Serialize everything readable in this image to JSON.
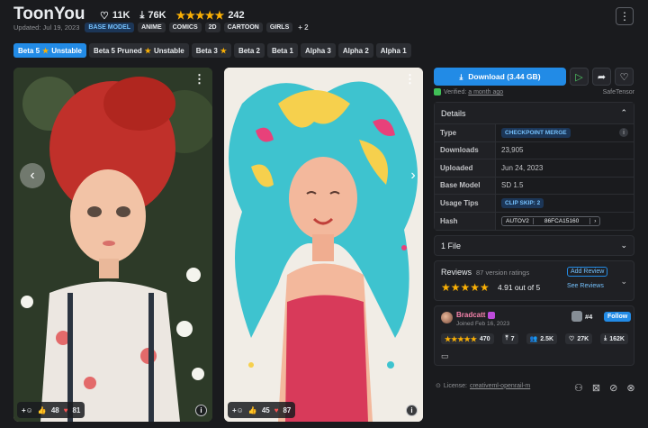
{
  "header": {
    "title": "ToonYou",
    "likes": "11K",
    "downloads": "76K",
    "rating_count": "242",
    "more_icon": "⋮"
  },
  "meta": {
    "updated": "Updated: Jul 19, 2023",
    "base_badge": "BASE MODEL",
    "tags": [
      "ANIME",
      "COMICS",
      "2D",
      "CARTOON",
      "GIRLS"
    ],
    "more_tags": "+ 2"
  },
  "versions": [
    {
      "label": "Beta 5",
      "star": true,
      "suffix": "Unstable",
      "active": true
    },
    {
      "label": "Beta 5 Pruned",
      "star": true,
      "suffix": "Unstable",
      "active": false
    },
    {
      "label": "Beta 3",
      "star": true,
      "suffix": "",
      "active": false
    },
    {
      "label": "Beta 2",
      "star": false,
      "suffix": "",
      "active": false
    },
    {
      "label": "Beta 1",
      "star": false,
      "suffix": "",
      "active": false
    },
    {
      "label": "Alpha 3",
      "star": false,
      "suffix": "",
      "active": false
    },
    {
      "label": "Alpha 2",
      "star": false,
      "suffix": "",
      "active": false
    },
    {
      "label": "Alpha 1",
      "star": false,
      "suffix": "",
      "active": false
    }
  ],
  "gallery": {
    "cards": [
      {
        "likes": "48",
        "hearts": "81"
      },
      {
        "likes": "45",
        "hearts": "87"
      }
    ]
  },
  "sidebar": {
    "download_label": "Download (3.44 GB)",
    "verified_prefix": "Verified:",
    "verified_when": "a month ago",
    "safetensor": "SafeTensor",
    "details_title": "Details",
    "details": {
      "type_label": "Type",
      "type_value": "CHECKPOINT MERGE",
      "downloads_label": "Downloads",
      "downloads_value": "23,905",
      "uploaded_label": "Uploaded",
      "uploaded_value": "Jun 24, 2023",
      "base_label": "Base Model",
      "base_value": "SD 1.5",
      "tips_label": "Usage Tips",
      "tips_value": "CLIP SKIP: 2",
      "hash_label": "Hash",
      "hash_algo": "AUTOV2",
      "hash_value": "86FCA15160"
    },
    "files_label": "1 File",
    "reviews": {
      "title": "Reviews",
      "count": "87 version ratings",
      "score": "4.91 out of 5",
      "add": "Add Review",
      "see": "See Reviews"
    },
    "creator": {
      "name": "Bradcatt",
      "joined": "Joined Feb 16, 2023",
      "rank": "#4",
      "follow": "Follow",
      "rating_count": "470",
      "uploads": "7",
      "followers": "2.5K",
      "likes": "27K",
      "downloads": "162K"
    },
    "license_prefix": "License:",
    "license_name": "creativeml-openrail-m"
  },
  "colors": {
    "accent": "#228be6",
    "background": "#1a1b1e",
    "star": "#fab005",
    "heart": "#fa5252"
  }
}
